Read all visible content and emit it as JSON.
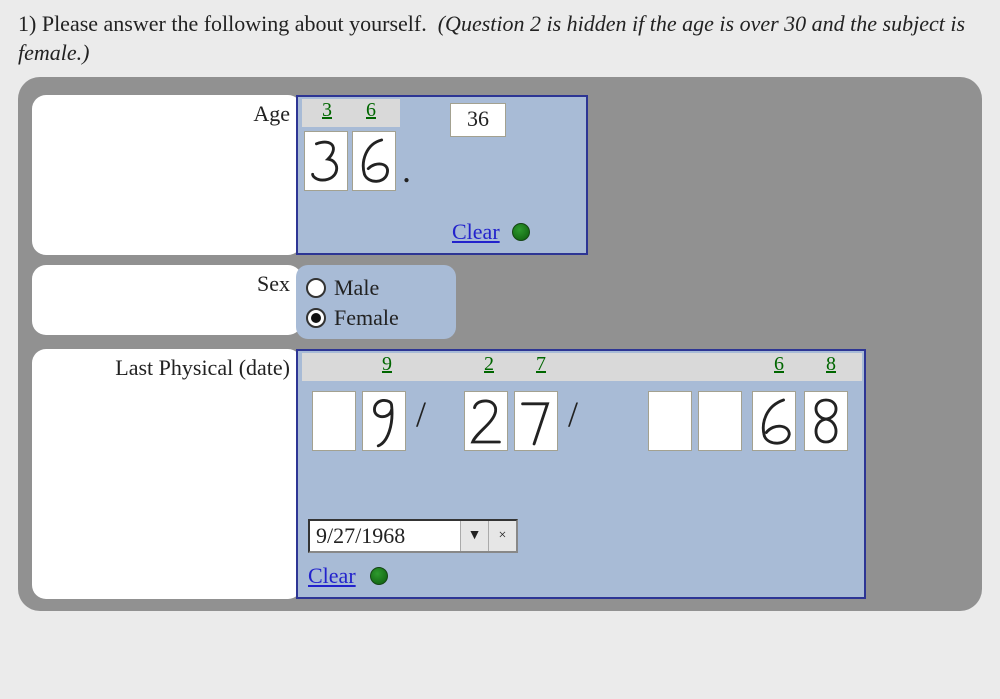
{
  "question": {
    "number": "1)",
    "text": "Please answer the following about yourself.",
    "note": "(Question 2 is hidden if the age is over 30 and the subject is female.)"
  },
  "age": {
    "label": "Age",
    "recognized_digits": [
      "3",
      "6"
    ],
    "value_text": "36",
    "dot_sep": ".",
    "clear_label": "Clear"
  },
  "sex": {
    "label": "Sex",
    "options": {
      "male": "Male",
      "female": "Female"
    },
    "selected": "female"
  },
  "date": {
    "label": "Last Physical (date)",
    "recognized_digits": [
      "",
      "9",
      "2",
      "7",
      "",
      "",
      "6",
      "8"
    ],
    "sep1": "/",
    "sep2": "/",
    "combo_value": "9/27/1968",
    "clear_label": "Clear",
    "dropdown_glyph": "▼",
    "x_glyph": "×"
  }
}
